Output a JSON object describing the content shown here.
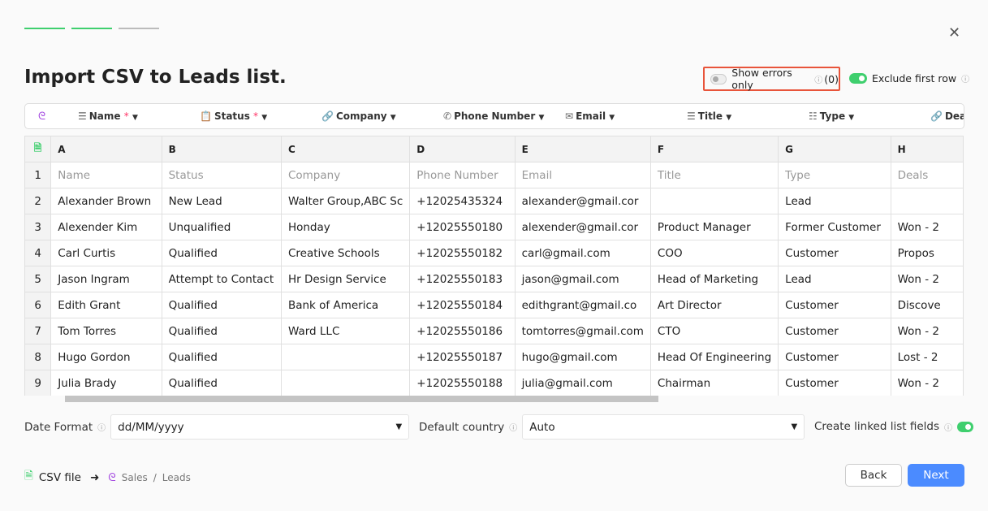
{
  "steps": [
    {
      "state": "done",
      "color": "#3fcf6e"
    },
    {
      "state": "done",
      "color": "#3fcf6e"
    },
    {
      "state": "pending",
      "color": "#bbbbbb"
    }
  ],
  "title": "Import CSV to Leads list.",
  "show_errors": {
    "label": "Show errors only",
    "count": "(0)",
    "enabled": false
  },
  "exclude_first_row": {
    "label": "Exclude first row",
    "enabled": true
  },
  "mapping": [
    {
      "icon": "☰",
      "label": "Name",
      "required": true
    },
    {
      "icon": "📋",
      "label": "Status",
      "required": true
    },
    {
      "icon": "🔗",
      "label": "Company",
      "required": false
    },
    {
      "icon": "✆",
      "label": "Phone Number",
      "required": false
    },
    {
      "icon": "✉",
      "label": "Email",
      "required": false
    },
    {
      "icon": "☰",
      "label": "Title",
      "required": false
    },
    {
      "icon": "☷",
      "label": "Type",
      "required": false
    },
    {
      "icon": "🔗",
      "label": "Deals",
      "required": false
    }
  ],
  "columns": [
    "A",
    "B",
    "C",
    "D",
    "E",
    "F",
    "G",
    "H"
  ],
  "rows": [
    [
      "1",
      "Name",
      "Status",
      "Company",
      "Phone Number",
      "Email",
      "Title",
      "Type",
      "Deals"
    ],
    [
      "2",
      "Alexander Brown",
      "New Lead",
      "Walter Group,ABC Sc",
      "+12025435324",
      "alexander@gmail.cor",
      "",
      "Lead",
      ""
    ],
    [
      "3",
      "Alexender Kim",
      "Unqualified",
      "Honday",
      "+12025550180",
      "alexender@gmail.cor",
      "Product Manager",
      "Former Customer",
      "Won - 2"
    ],
    [
      "4",
      "Carl Curtis",
      "Qualified",
      "Creative Schools",
      "+12025550182",
      "carl@gmail.com",
      "COO",
      "Customer",
      "Propos"
    ],
    [
      "5",
      "Jason Ingram",
      "Attempt to Contact",
      "Hr Design Service",
      "+12025550183",
      "jason@gmail.com",
      "Head of Marketing",
      "Lead",
      "Won - 2"
    ],
    [
      "6",
      "Edith Grant",
      "Qualified",
      "Bank of America",
      "+12025550184",
      "edithgrant@gmail.co",
      "Art Director",
      "Customer",
      "Discove"
    ],
    [
      "7",
      "Tom Torres",
      "Qualified",
      "Ward LLC",
      "+12025550186",
      "tomtorres@gmail.com",
      "CTO",
      "Customer",
      "Won - 2"
    ],
    [
      "8",
      "Hugo Gordon",
      "Qualified",
      "",
      "+12025550187",
      "hugo@gmail.com",
      "Head Of Engineering",
      "Customer",
      "Lost - 2"
    ],
    [
      "9",
      "Julia Brady",
      "Qualified",
      "",
      "+12025550188",
      "julia@gmail.com",
      "Chairman",
      "Customer",
      "Won - 2"
    ]
  ],
  "date_format": {
    "label": "Date Format",
    "value": "dd/MM/yyyy"
  },
  "default_country": {
    "label": "Default country",
    "value": "Auto"
  },
  "linked": {
    "label": "Create linked list fields",
    "enabled": true
  },
  "breadcrumb": {
    "source": "CSV file",
    "app": "Sales",
    "list": "Leads"
  },
  "buttons": {
    "back": "Back",
    "next": "Next"
  },
  "colors": {
    "accent": "#4b8bff",
    "success": "#3fcf6e",
    "error_outline": "#e8543a"
  }
}
